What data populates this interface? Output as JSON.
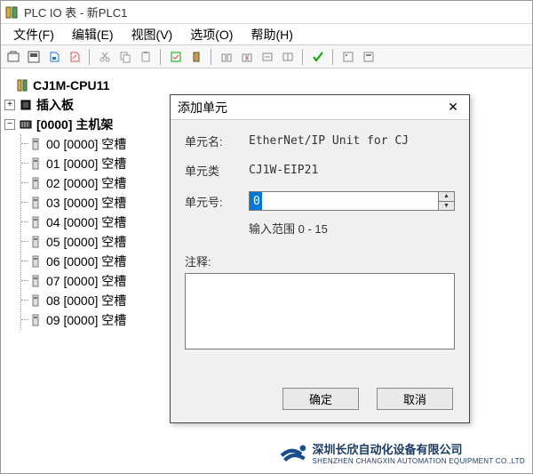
{
  "window": {
    "title": "PLC IO 表 - 新PLC1"
  },
  "menu": {
    "file": "文件(F)",
    "edit": "编辑(E)",
    "view": "视图(V)",
    "options": "选项(O)",
    "help": "帮助(H)"
  },
  "tree": {
    "root": "CJ1M-CPU11",
    "insert_board": "插入板",
    "rack": "[0000] 主机架",
    "slots": [
      "00 [0000] 空槽",
      "01 [0000] 空槽",
      "02 [0000] 空槽",
      "03 [0000] 空槽",
      "04 [0000] 空槽",
      "05 [0000] 空槽",
      "06 [0000] 空槽",
      "07 [0000] 空槽",
      "08 [0000] 空槽",
      "09 [0000] 空槽"
    ]
  },
  "dialog": {
    "title": "添加单元",
    "unit_name_label": "单元名:",
    "unit_name_value": "EtherNet/IP Unit for CJ",
    "unit_type_label": "单元类",
    "unit_type_value": "CJ1W-EIP21",
    "unit_no_label": "单元号:",
    "unit_no_value": "0",
    "range_hint": "输入范围 0 - 15",
    "remarks_label": "注释:",
    "remarks_value": "",
    "ok": "确定",
    "cancel": "取消"
  },
  "watermark": {
    "cn": "深圳长欣自动化设备有限公司",
    "en": "SHENZHEN CHANGXIN AUTOMATION EQUIPMENT CO.,LTD"
  }
}
